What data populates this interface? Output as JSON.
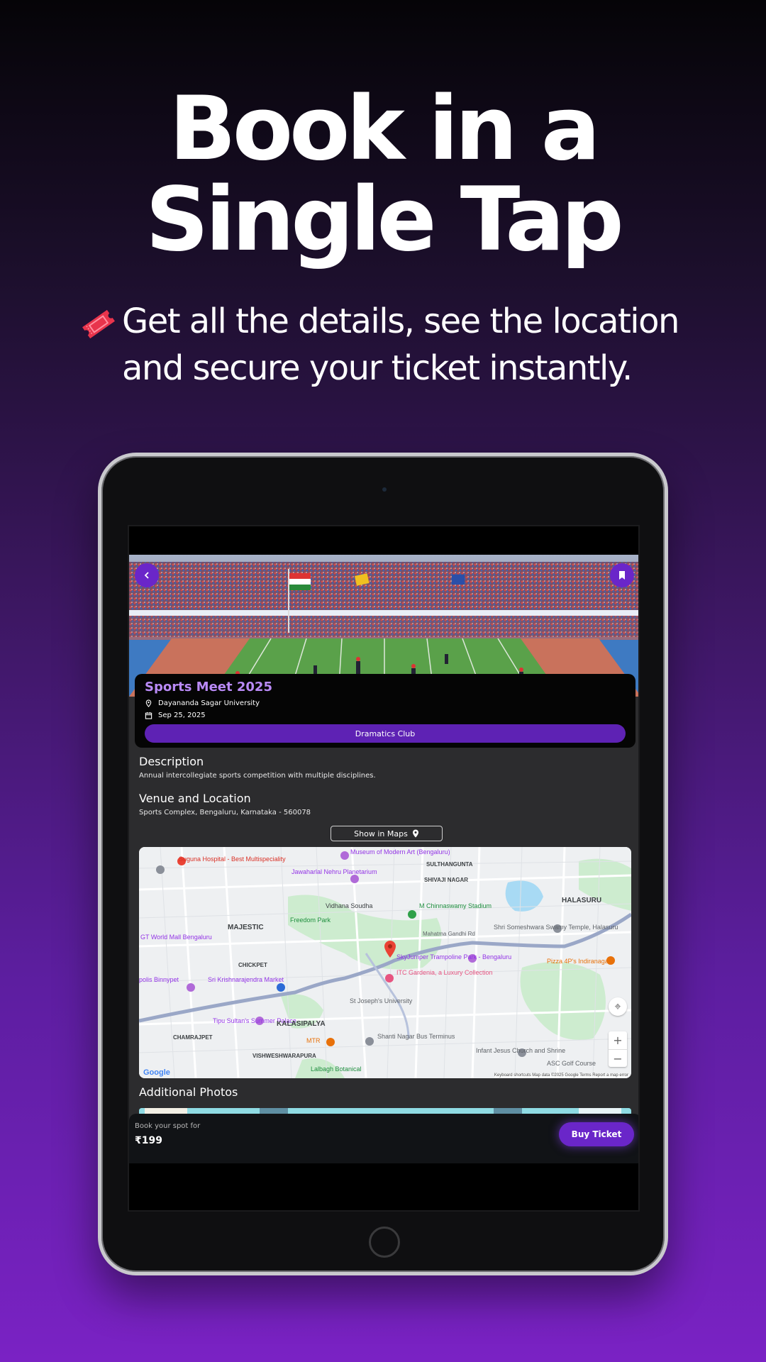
{
  "headline": {
    "line1": "Book in a",
    "line2": "Single Tap"
  },
  "subheadline": {
    "line1": "Get all the details, see the location",
    "line2": "and secure your ticket instantly."
  },
  "icons": {
    "ticket": "ticket-icon",
    "back": "chevron-left-icon",
    "bookmark": "bookmark-icon",
    "location": "location-pin-icon",
    "calendar": "calendar-icon"
  },
  "colors": {
    "accent": "#6a26c9",
    "title": "#b98af6",
    "background_top": "#050407",
    "background_bottom": "#7a22c4"
  },
  "event": {
    "title": "Sports Meet 2025",
    "venue": "Dayananda Sagar University",
    "date": "Sep 25, 2025",
    "club": "Dramatics Club"
  },
  "description": {
    "heading": "Description",
    "text": "Annual intercollegiate sports competition with multiple disciplines."
  },
  "venue_section": {
    "heading": "Venue and Location",
    "address": "Sports Complex, Bengaluru, Karnataka - 560078",
    "maps_button": "Show in Maps"
  },
  "map": {
    "labels": {
      "hospital": "Suguna Hospital - Best Multispeciality",
      "museum": "Museum of Modern Art (Bengaluru)",
      "sulthanagunta": "SULTHANGUNTA",
      "planetarium": "Jawaharlal Nehru Planetarium",
      "shivaji": "SHIVAJI NAGAR",
      "halasuru": "HALASURU",
      "majestic": "MAJESTIC",
      "freedom_park": "Freedom Park",
      "vidhana": "Vidhana Soudha",
      "stadium": "M Chinnaswamy Stadium",
      "temple": "Shri Someshwara Swamy Temple, Halasuru",
      "gt_mall": "GT World Mall Bengaluru",
      "mahatma": "Mahatma Gandhi Rd",
      "chickpet": "CHICKPET",
      "skyjumper": "SkyJumper Trampoline Park - Bengaluru",
      "pizza": "Pizza 4P's Indiranagar",
      "binnypet": "polis Binnypet",
      "krishnarajendra": "Sri Krishnarajendra Market",
      "itc": "ITC Gardenia, a Luxury Collection",
      "stjoseph": "St Joseph's University",
      "tipu": "Tipu Sultan's Summer Palace",
      "kalasipalya": "KALASIPALYA",
      "chamrajpet": "CHAMRAJPET",
      "mtr": "MTR",
      "shanti": "Shanti Nagar Bus Terminus",
      "infant": "Infant Jesus Church and Shrine",
      "asc": "ASC Golf Course",
      "vishweshwarapura": "VISHWESHWARAPURA",
      "lalbagh": "Lalbagh Botanical"
    },
    "zoom_in": "+",
    "zoom_out": "−",
    "google": "Google",
    "attribution": "Keyboard shortcuts   Map data ©2025 Google   Terms   Report a map error"
  },
  "photos": {
    "heading": "Additional Photos"
  },
  "booking": {
    "label": "Book your spot for",
    "price": "₹199",
    "button": "Buy Ticket"
  }
}
